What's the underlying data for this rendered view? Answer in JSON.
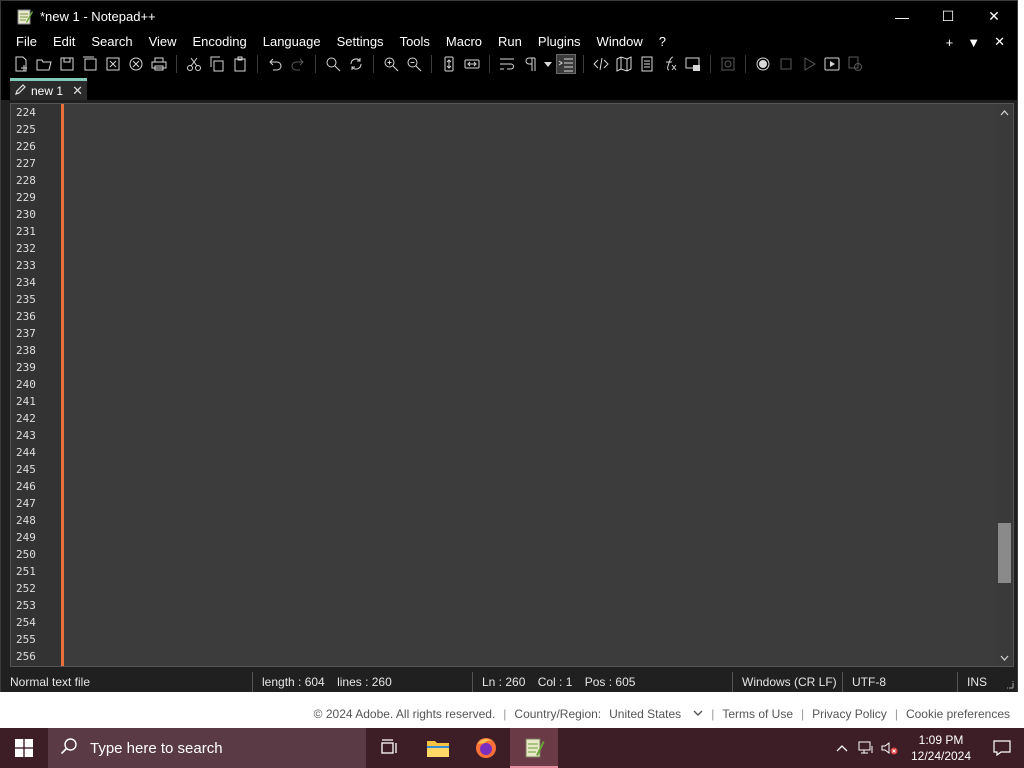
{
  "window": {
    "title": "*new 1 - Notepad++",
    "minimize": "—",
    "maximize": "☐",
    "close": "✕"
  },
  "menu": {
    "items": [
      "File",
      "Edit",
      "Search",
      "View",
      "Encoding",
      "Language",
      "Settings",
      "Tools",
      "Macro",
      "Run",
      "Plugins",
      "Window",
      "?"
    ],
    "right_plus": "+",
    "right_down": "▼",
    "right_close": "✕"
  },
  "tab": {
    "label": "new 1",
    "close": "✕"
  },
  "editor": {
    "line_numbers": [
      "224",
      "225",
      "226",
      "227",
      "228",
      "229",
      "230",
      "231",
      "232",
      "233",
      "234",
      "235",
      "236",
      "237",
      "238",
      "239",
      "240",
      "241",
      "242",
      "243",
      "244",
      "245",
      "246",
      "247",
      "248",
      "249",
      "250",
      "251",
      "252",
      "253",
      "254",
      "255",
      "256"
    ],
    "scroll_position_fraction": 0.86
  },
  "statusbar": {
    "file_type": "Normal text file",
    "length": "length : 604",
    "lines": "lines : 260",
    "ln": "Ln : 260",
    "col": "Col : 1",
    "pos": "Pos : 605",
    "eol": "Windows (CR LF)",
    "encoding": "UTF-8",
    "mode": "INS"
  },
  "footer": {
    "copyright": "© 2024 Adobe. All rights reserved.",
    "region_label": "Country/Region:",
    "region_value": "United States",
    "terms": "Terms of Use",
    "privacy": "Privacy Policy",
    "cookies": "Cookie preferences"
  },
  "taskbar": {
    "search_placeholder": "Type here to search",
    "time": "1:09 PM",
    "date": "12/24/2024"
  },
  "colors": {
    "tab_accent": "#80c8b8",
    "fold_margin": "#e8703a",
    "taskbar_bg": "#3d1e26"
  }
}
